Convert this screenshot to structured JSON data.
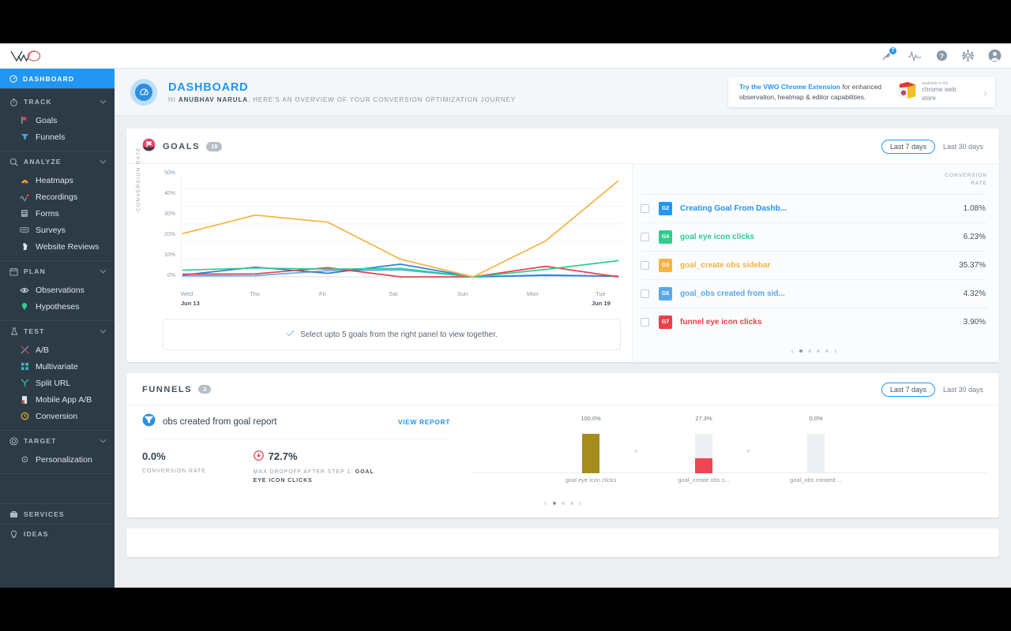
{
  "brand": {
    "logo_name": "VWO"
  },
  "topbar": {
    "icons": [
      {
        "name": "notifications-icon",
        "badge": "7"
      },
      {
        "name": "activity-pulse-icon",
        "badge": ""
      },
      {
        "name": "help-icon",
        "badge": ""
      },
      {
        "name": "settings-gear-icon",
        "badge": ""
      },
      {
        "name": "user-avatar-icon",
        "badge": ""
      }
    ]
  },
  "sidebar": {
    "active": {
      "label": "DASHBOARD",
      "icon": "dashboard-icon"
    },
    "sections": [
      {
        "label": "TRACK",
        "icon": "stopwatch-icon",
        "items": [
          {
            "label": "Goals",
            "icon": "flag-icon"
          },
          {
            "label": "Funnels",
            "icon": "funnel-icon"
          }
        ]
      },
      {
        "label": "ANALYZE",
        "icon": "magnifier-icon",
        "items": [
          {
            "label": "Heatmaps",
            "icon": "heatmap-icon"
          },
          {
            "label": "Recordings",
            "icon": "recording-icon"
          },
          {
            "label": "Forms",
            "icon": "form-icon"
          },
          {
            "label": "Surveys",
            "icon": "survey-icon"
          },
          {
            "label": "Website Reviews",
            "icon": "cursor-icon"
          }
        ]
      },
      {
        "label": "PLAN",
        "icon": "calendar-icon",
        "items": [
          {
            "label": "Observations",
            "icon": "eye-icon"
          },
          {
            "label": "Hypotheses",
            "icon": "pin-icon"
          }
        ]
      },
      {
        "label": "TEST",
        "icon": "flask-icon",
        "items": [
          {
            "label": "A/B",
            "icon": "ab-split-icon"
          },
          {
            "label": "Multivariate",
            "icon": "grid-icon"
          },
          {
            "label": "Split URL",
            "icon": "branch-icon"
          },
          {
            "label": "Mobile App A/B",
            "icon": "mobile-icon"
          },
          {
            "label": "Conversion",
            "icon": "conversion-icon"
          }
        ]
      },
      {
        "label": "TARGET",
        "icon": "target-icon",
        "items": [
          {
            "label": "Personalization",
            "icon": "personalization-icon"
          }
        ]
      }
    ],
    "footer": [
      {
        "label": "SERVICES",
        "icon": "briefcase-icon"
      },
      {
        "label": "IDEAS",
        "icon": "lightbulb-icon"
      }
    ]
  },
  "page_header": {
    "icon": "dashboard-badge-icon",
    "title": "DASHBOARD",
    "greeting_prefix": "HI ",
    "user_name": "ANUBHAV NARULA",
    "greeting_suffix": ", HERE'S AN OVERVIEW OF YOUR CONVERSION OPTIMIZATION JOURNEY",
    "promo": {
      "link_text": "Try the VWO Chrome Extension",
      "rest_text": " for enhanced observation, heatmap & editor capabilities.",
      "store_small": "available in the",
      "store_big": "chrome web store",
      "chevron": "›"
    }
  },
  "goals_card": {
    "icon": "goal-flag-icon",
    "title": "GOALS",
    "count": "18",
    "range": {
      "selected": "Last 7 days",
      "other": "Last 30 days"
    },
    "hint": {
      "icon": "check-icon",
      "text": "Select upto 5 goals from the right panel to view together."
    },
    "list_header": "CONVERSION\nRATE",
    "list_header_line1": "CONVERSION",
    "list_header_line2": "RATE",
    "goals": [
      {
        "tag": "G2",
        "name": "Creating Goal From Dashb...",
        "rate": "1.08%",
        "color": "#2196f3"
      },
      {
        "tag": "G4",
        "name": "goal eye icon clicks",
        "rate": "6.23%",
        "color": "#2ecc8f"
      },
      {
        "tag": "G5",
        "name": "goal_create obs sidebar",
        "rate": "35.37%",
        "color": "#f5b342"
      },
      {
        "tag": "G6",
        "name": "goal_obs created from sid...",
        "rate": "4.32%",
        "color": "#5aa9e6"
      },
      {
        "tag": "G7",
        "name": "funnel eye icon clicks",
        "rate": "3.90%",
        "color": "#e8414a"
      }
    ],
    "pagination": {
      "prev": "‹",
      "next": "›",
      "pages": 4,
      "active": 1
    }
  },
  "chart_data": {
    "type": "line",
    "title": "Goals conversion rate over last 7 days",
    "xlabel": "",
    "ylabel": "CONVERSION RATE",
    "x": [
      "Wed",
      "Thu",
      "Fri",
      "Sat",
      "Sun",
      "Mon",
      "Tue"
    ],
    "x_start_date": "Jun 13",
    "x_end_date": "Jun 19",
    "ytick_labels": [
      "0%",
      "10%",
      "20%",
      "30%",
      "40%",
      "50%"
    ],
    "ylim": [
      0,
      55
    ],
    "grid": true,
    "legend": "right-panel",
    "series": [
      {
        "name": "goal_create obs sidebar",
        "tag": "G5",
        "color": "#f5b342",
        "values": [
          24.5,
          35.0,
          31.0,
          10.0,
          0.0,
          20.5,
          54.5
        ]
      },
      {
        "name": "goal eye icon clicks",
        "tag": "G4",
        "color": "#2ecc8f",
        "values": [
          3.8,
          5.0,
          4.4,
          4.8,
          0.0,
          4.2,
          9.2
        ]
      },
      {
        "name": "funnel eye icon clicks",
        "tag": "G7",
        "color": "#e8414a",
        "values": [
          1.5,
          1.7,
          5.2,
          0.0,
          0.0,
          6.0,
          0.0
        ]
      },
      {
        "name": "goal_obs created from sid...",
        "tag": "G6",
        "color": "#2f7fd4",
        "values": [
          1.0,
          5.5,
          2.0,
          7.2,
          0.0,
          0.8,
          0.4
        ]
      },
      {
        "name": "Creating Goal From Dashb...",
        "tag": "G2",
        "color": "#5aa9e6",
        "values": [
          0.6,
          0.7,
          3.5,
          4.0,
          0.0,
          1.1,
          0.3
        ]
      }
    ]
  },
  "funnels_card": {
    "title": "FUNNELS",
    "count": "3",
    "range": {
      "selected": "Last 7 days",
      "other": "Last 30 days"
    },
    "icon": "funnel-icon",
    "name": "obs created from goal report",
    "view_report": "VIEW REPORT",
    "metrics": [
      {
        "value": "0.0%",
        "caption": "CONVERSION RATE",
        "icon": ""
      },
      {
        "value": "72.7%",
        "caption_prefix": "MAX DROPOFF AFTER STEP 1: ",
        "caption_bold": "GOAL EYE ICON CLICKS",
        "icon": "dropoff-icon"
      }
    ],
    "funnel_chart": {
      "type": "bar",
      "categories": [
        "goal eye icon clicks",
        "goal_create obs s...",
        "goal_obs created ..."
      ],
      "values": [
        100.0,
        27.3,
        0.0
      ],
      "value_labels": [
        "100.0%",
        "27.3%",
        "0.0%"
      ],
      "bar_colors": [
        "#a58c1e",
        "#eceef0",
        "#eceef0"
      ],
      "dropoff_color": "#ef4654",
      "dropoff_values": [
        0,
        27.3,
        0
      ],
      "ylim": [
        0,
        100
      ]
    },
    "pagination": {
      "prev": "‹",
      "next": "›",
      "pages": 3,
      "active": 1
    }
  }
}
